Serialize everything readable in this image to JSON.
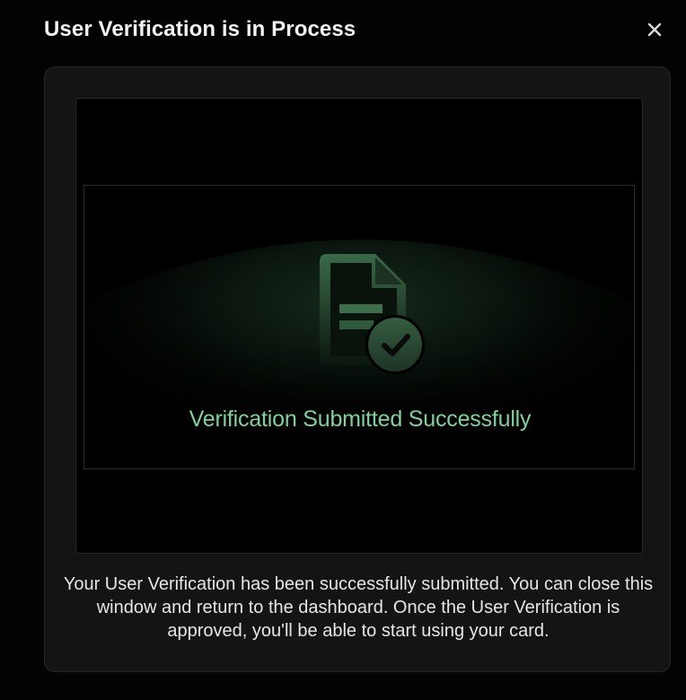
{
  "modal": {
    "title": "User Verification is in Process",
    "close_icon": "close-icon"
  },
  "media": {
    "icon": "document-check-icon",
    "headline": "Verification Submitted Successfully"
  },
  "description": "Your User Verification has been successfully submitted. You can close this window and return to the dashboard. Once the User Verification is approved, you'll be able to start using your card.",
  "colors": {
    "background": "#000000",
    "card": "#141414",
    "accent": "#7ed39b",
    "icon_green": "#2f5a3b"
  }
}
